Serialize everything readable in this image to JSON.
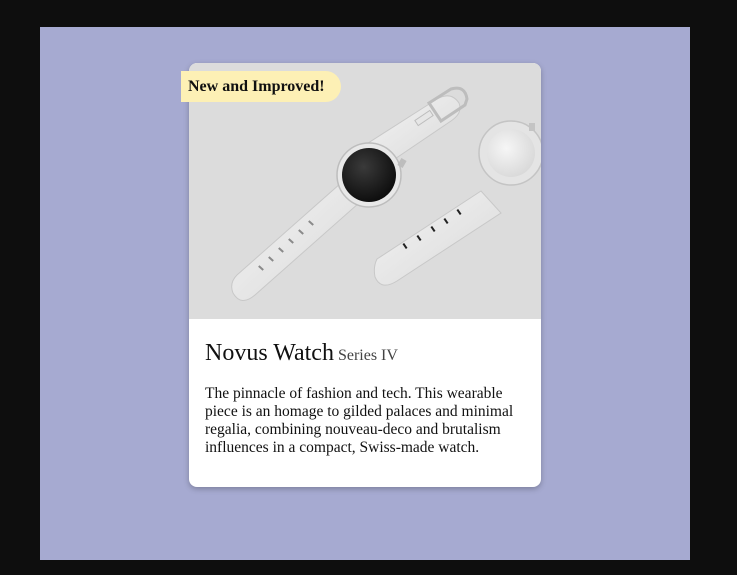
{
  "badge": {
    "label": "New and Improved!"
  },
  "product": {
    "title": "Novus Watch",
    "subtitle": "Series IV",
    "description": "The pinnacle of fashion and tech. This wearable piece is an homage to gilded palaces and minimal regalia, combining nouveau-deco and brutalism influences in a compact, Swiss-made watch."
  },
  "colors": {
    "page_background": "#a6aad1",
    "card_background": "#ffffff",
    "badge_background": "#fdf0b5",
    "image_background": "#dcdcdc"
  }
}
